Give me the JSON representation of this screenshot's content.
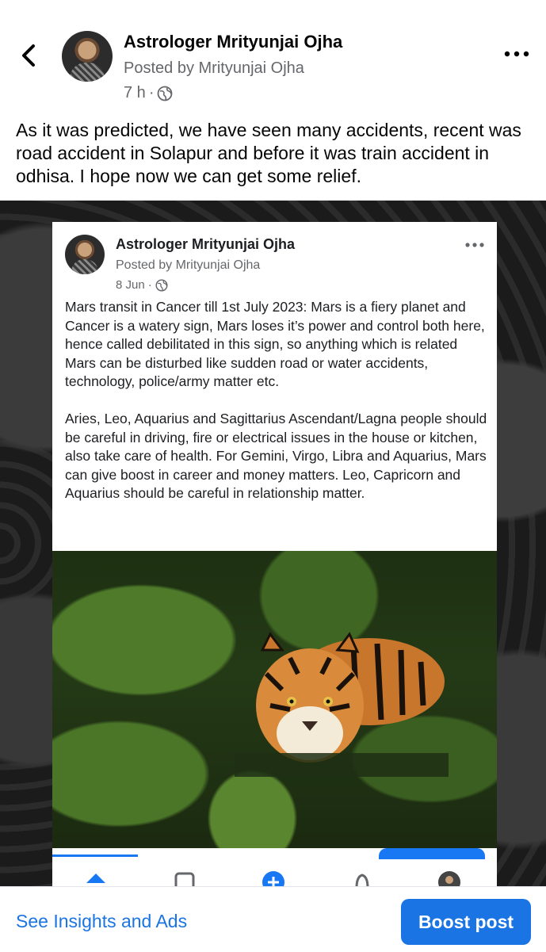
{
  "post": {
    "author": "Astrologer Mrityunjai Ojha",
    "posted_by": "Posted by Mrityunjai Ojha",
    "time": "7 h",
    "caption": "As it was predicted, we have seen many accidents, recent was road accident in Solapur and before it was train accident in odhisa. I hope now we can get some relief."
  },
  "shared_post": {
    "author": "Astrologer Mrityunjai Ojha",
    "posted_by": "Posted by Mrityunjai Ojha",
    "date": "8 Jun",
    "paragraph1": "Mars transit in Cancer till 1st July 2023: Mars is a fiery planet and Cancer is a watery sign, Mars loses it’s power and control both here, hence called debilitated in this sign, so anything which is related Mars can be disturbed like sudden road or water accidents, technology, police/army matter etc.",
    "paragraph2": "Aries, Leo, Aquarius and Sagittarius Ascendant/Lagna people should be careful in driving, fire or electrical issues in the house or kitchen, also take care of health. For Gemini, Virgo, Libra and Aquarius, Mars can give boost in career and money matters. Leo, Capricorn and Aquarius should be careful in relationship matter."
  },
  "footer": {
    "insights_label": "See Insights and Ads",
    "boost_label": "Boost post"
  },
  "icons": {
    "back": "chevron-left-icon",
    "more": "more-horizontal-icon",
    "audience": "globe-icon"
  },
  "colors": {
    "accent": "#1b74e4",
    "secondary_text": "#65676b"
  }
}
